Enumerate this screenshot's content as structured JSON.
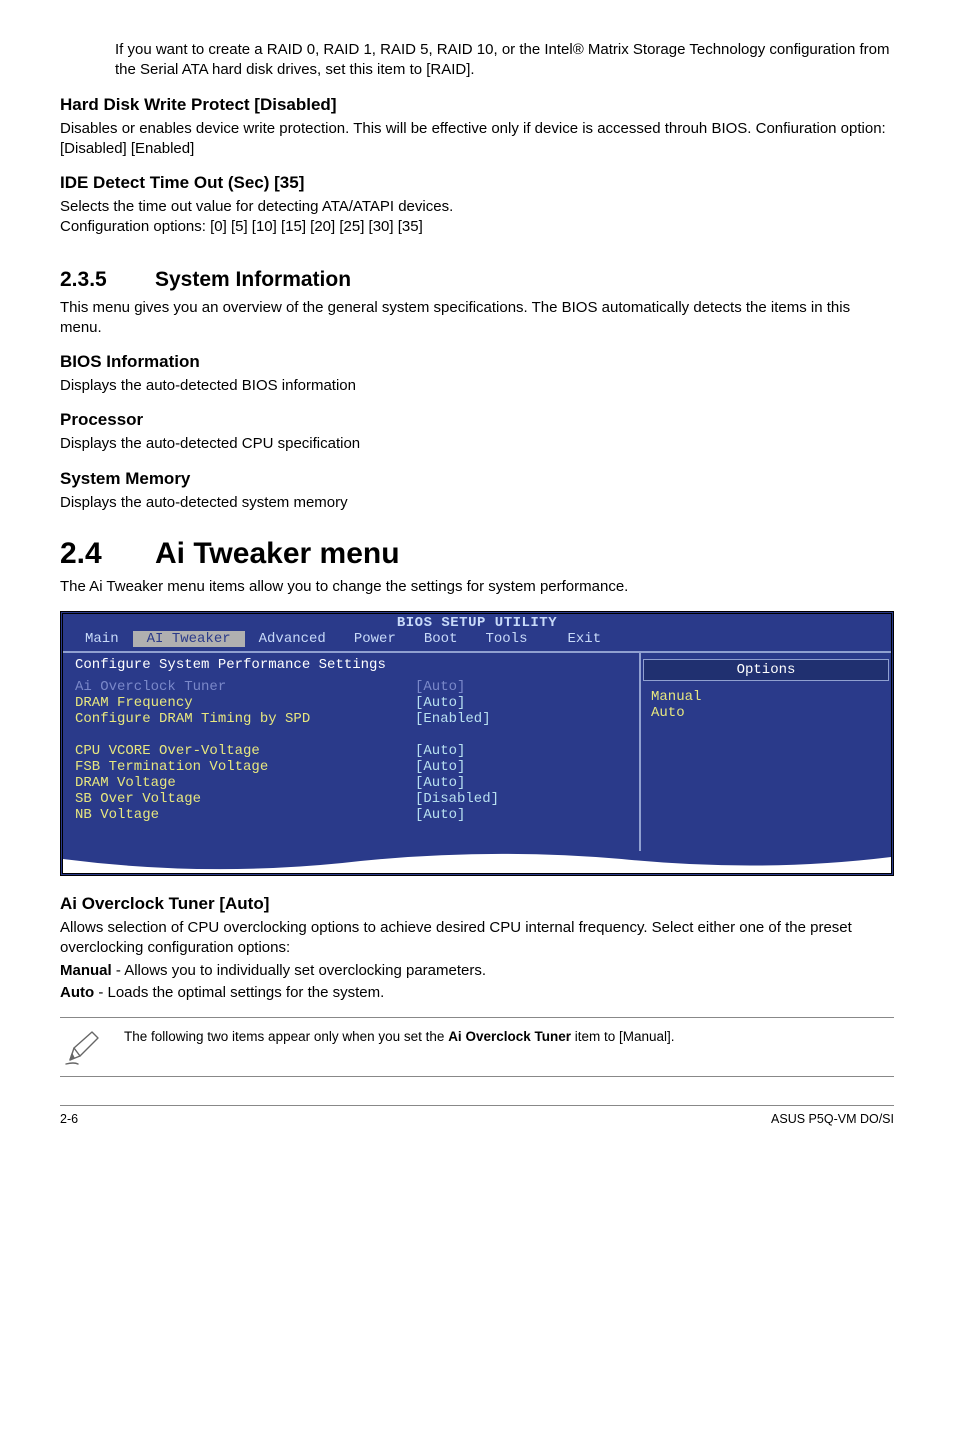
{
  "intro_para": "If you want to create a RAID 0, RAID 1,  RAID 5,  RAID 10, or the Intel® Matrix Storage Technology configuration from the Serial ATA hard disk drives, set this item to [RAID].",
  "hard_disk": {
    "heading": "Hard Disk Write Protect [Disabled]",
    "body": "Disables or enables device write protection. This will be effective only if device is accessed throuh BIOS. Confiuration option: [Disabled] [Enabled]"
  },
  "ide": {
    "heading": "IDE Detect Time Out (Sec) [35]",
    "body1": "Selects the time out value for detecting ATA/ATAPI devices.",
    "body2": "Configuration options: [0] [5] [10] [15] [20] [25] [30] [35]"
  },
  "sec235": {
    "num": "2.3.5",
    "title": "System Information",
    "intro": "This menu gives you an overview of the general system specifications. The BIOS automatically detects the items in this menu.",
    "bios_info_h": "BIOS Information",
    "bios_info_b": "Displays the auto-detected BIOS information",
    "proc_h": "Processor",
    "proc_b": "Displays the auto-detected CPU specification",
    "mem_h": "System Memory",
    "mem_b": "Displays the auto-detected system memory"
  },
  "sec24": {
    "num": "2.4",
    "title": "Ai Tweaker menu",
    "intro": "The Ai Tweaker menu items allow you to change the settings for system performance."
  },
  "bios": {
    "title": "BIOS SETUP UTILITY",
    "menu": [
      "Main",
      "AI Tweaker",
      "Advanced",
      "Power",
      "Boot",
      "Tools",
      "Exit"
    ],
    "config_heading": "Configure System Performance Settings",
    "rows": [
      {
        "label": "Ai Overclock Tuner",
        "val": "[Auto]",
        "style": "disabled"
      },
      {
        "label": "DRAM Frequency",
        "val": "[Auto]",
        "style": "yellow-cyan"
      },
      {
        "label": "Configure DRAM Timing by SPD",
        "val": "[Enabled]",
        "style": "yellow-cyan"
      },
      {
        "label": "",
        "val": "",
        "style": "blank"
      },
      {
        "label": "CPU VCORE Over-Voltage",
        "val": "[Auto]",
        "style": "yellow-cyan"
      },
      {
        "label": "FSB Termination Voltage",
        "val": "[Auto]",
        "style": "yellow-cyan"
      },
      {
        "label": "DRAM Voltage",
        "val": "[Auto]",
        "style": "yellow-cyan"
      },
      {
        "label": "SB Over Voltage",
        "val": "[Disabled]",
        "style": "yellow-cyan"
      },
      {
        "label": "NB Voltage",
        "val": "[Auto]",
        "style": "yellow-cyan"
      }
    ],
    "options_header": "Options",
    "options": [
      "Manual",
      "Auto"
    ]
  },
  "ai_tuner": {
    "heading": "Ai Overclock Tuner [Auto]",
    "body1": "Allows selection of CPU overclocking options to achieve desired CPU internal frequency. Select either one of the preset overclocking configuration options:",
    "manual_label": "Manual",
    "manual_rest": " - Allows you to individually set overclocking parameters.",
    "auto_label": "Auto",
    "auto_rest": " - Loads the optimal settings for the system."
  },
  "note": {
    "pre": "The following two items appear only when you set the ",
    "bold": "Ai Overclock Tuner",
    "post": " item to [Manual]."
  },
  "footer": {
    "left": "2-6",
    "right": "ASUS P5Q-VM DO/SI"
  }
}
